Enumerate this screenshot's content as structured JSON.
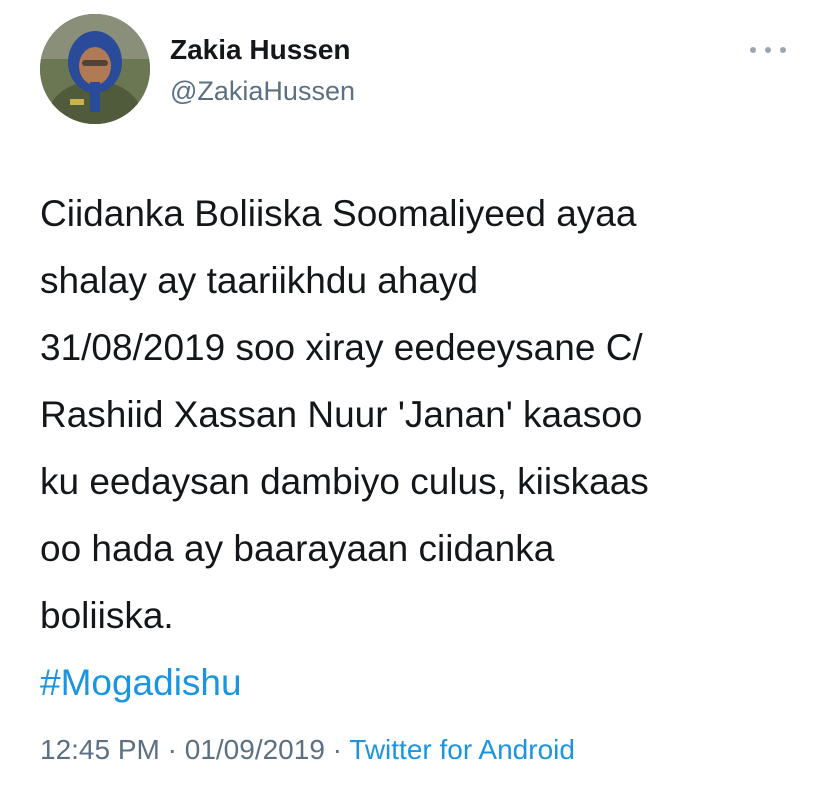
{
  "user": {
    "display_name": "Zakia Hussen",
    "handle": "@ZakiaHussen",
    "avatar_icon": "profile-photo"
  },
  "header": {
    "more_icon": "more-horizontal-icon"
  },
  "tweet": {
    "lines": [
      "Ciidanka Boliiska Soomaliyeed ayaa",
      "shalay ay taariikhdu ahayd",
      "31/08/2019 soo xiray eedeeysane C/",
      "Rashiid Xassan Nuur 'Janan' kaasoo",
      "ku eedaysan dambiyo culus, kiiskaas",
      "oo hada ay baarayaan ciidanka",
      "boliiska."
    ],
    "hashtag": "#Mogadishu"
  },
  "meta": {
    "time": "12:45 PM",
    "separator": "·",
    "date": "01/09/2019",
    "source": "Twitter for Android"
  },
  "colors": {
    "link": "#1b95e0",
    "secondary": "#5b7083",
    "text": "#14171a"
  }
}
